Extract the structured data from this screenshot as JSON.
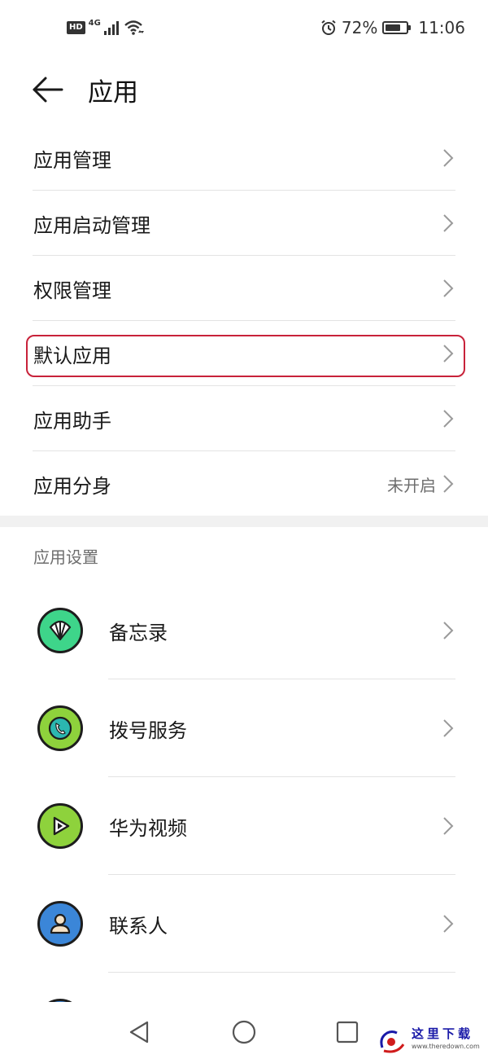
{
  "status_bar": {
    "hd": "HD",
    "network": "4G",
    "battery_percent": "72%",
    "battery_level": 0.72,
    "time": "11:06"
  },
  "header": {
    "title": "应用"
  },
  "menu": {
    "items": [
      {
        "label": "应用管理",
        "value": ""
      },
      {
        "label": "应用启动管理",
        "value": ""
      },
      {
        "label": "权限管理",
        "value": ""
      },
      {
        "label": "默认应用",
        "value": ""
      },
      {
        "label": "应用助手",
        "value": ""
      },
      {
        "label": "应用分身",
        "value": "未开启"
      }
    ]
  },
  "app_settings": {
    "title": "应用设置",
    "items": [
      {
        "label": "备忘录",
        "icon": "memo-icon",
        "color": "#3ed58a"
      },
      {
        "label": "拨号服务",
        "icon": "phone-icon",
        "color": "#8ed23c"
      },
      {
        "label": "华为视频",
        "icon": "video-play-icon",
        "color": "#8ed23c"
      },
      {
        "label": "联系人",
        "icon": "contact-icon",
        "color": "#3b86d8"
      },
      {
        "label": "",
        "icon": "app-icon",
        "color": "#3b86d8"
      }
    ]
  },
  "watermark": {
    "text": "这里下载",
    "url": "www.theredown.com"
  },
  "colors": {
    "highlight": "#c8223a",
    "divider": "#e3e3e3",
    "secondary_text": "#6e6e6e"
  }
}
